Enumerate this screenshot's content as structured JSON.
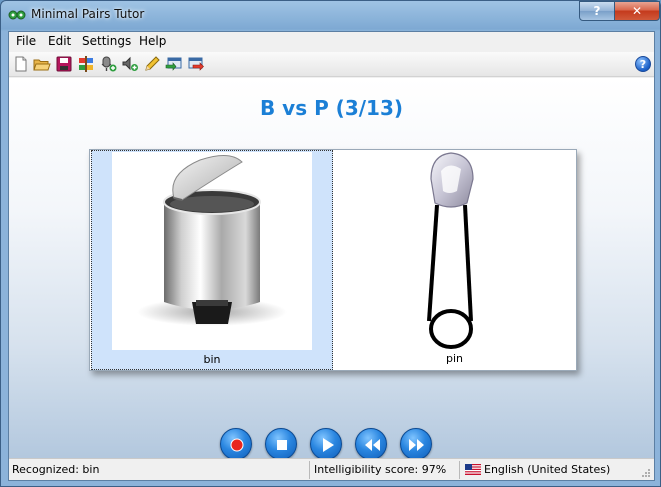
{
  "window": {
    "title": "Minimal Pairs Tutor",
    "help_button": "?",
    "close_button": "✕"
  },
  "menu": {
    "items": [
      "File",
      "Edit",
      "Settings",
      "Help"
    ]
  },
  "toolbar": {
    "icons": [
      "new-file-icon",
      "open-folder-icon",
      "save-icon",
      "settings-icon",
      "microphone-add-icon",
      "speaker-add-icon",
      "edit-pencil-icon",
      "import-icon",
      "export-icon"
    ],
    "help_label": "?"
  },
  "lesson": {
    "title": "B vs P (3/13)",
    "pairs": [
      {
        "word": "bin",
        "icon": "trash-bin-icon",
        "selected": true
      },
      {
        "word": "pin",
        "icon": "safety-pin-icon",
        "selected": false
      }
    ]
  },
  "controls": [
    "record-icon",
    "stop-icon",
    "play-icon",
    "rewind-icon",
    "fast-forward-icon"
  ],
  "status": {
    "recognized": "Recognized: bin",
    "score": "Intelligibility score: 97%",
    "language": "English (United States)"
  },
  "colors": {
    "title": "#1b7fd6",
    "selection": "#cfe3fb",
    "record": "#e8261e",
    "transport": "#2a86e0"
  }
}
